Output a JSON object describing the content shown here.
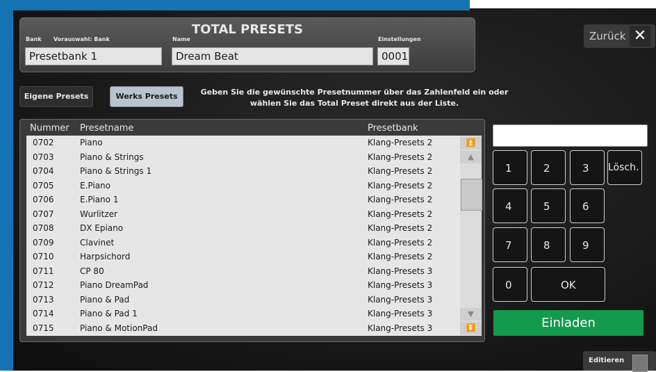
{
  "header": {
    "title": "TOTAL PRESETS",
    "bank_label": "Bank",
    "preselect_label": "Vorauswahl: Bank",
    "name_label": "Name",
    "settings_label": "Einstellungen",
    "bank_value": "Presetbank 1",
    "name_value": "Dream Beat",
    "settings_value": "0001"
  },
  "back_label": "Zurück",
  "tabs": {
    "own": "Eigene Presets",
    "works": "Werks Presets"
  },
  "hint": "Geben Sie die gewünschte Presetnummer über das Zahlenfeld ein oder wählen Sie das Total Preset direkt aus der Liste.",
  "table": {
    "columns": [
      "Nummer",
      "Presetname",
      "Presetbank"
    ],
    "rows": [
      [
        "0702",
        "Piano",
        "Klang-Presets 2"
      ],
      [
        "0703",
        "Piano & Strings",
        "Klang-Presets 2"
      ],
      [
        "0704",
        "Piano & Strings 1",
        "Klang-Presets 2"
      ],
      [
        "0705",
        "E.Piano",
        "Klang-Presets 2"
      ],
      [
        "0706",
        "E.Piano 1",
        "Klang-Presets 2"
      ],
      [
        "0707",
        "Wurlitzer",
        "Klang-Presets 2"
      ],
      [
        "0708",
        "DX Epiano",
        "Klang-Presets 2"
      ],
      [
        "0709",
        "Clavinet",
        "Klang-Presets 2"
      ],
      [
        "0710",
        "Harpsichord",
        "Klang-Presets 2"
      ],
      [
        "0711",
        "CP 80",
        "Klang-Presets 3"
      ],
      [
        "0712",
        "Piano DreamPad",
        "Klang-Presets 3"
      ],
      [
        "0713",
        "Piano & Pad",
        "Klang-Presets 3"
      ],
      [
        "0714",
        "Piano & Pad 1",
        "Klang-Presets 3"
      ],
      [
        "0715",
        "Piano & MotionPad",
        "Klang-Presets 3"
      ]
    ]
  },
  "keypad": {
    "k1": "1",
    "k2": "2",
    "k3": "3",
    "del": "Lösch.",
    "k4": "4",
    "k5": "5",
    "k6": "6",
    "k7": "7",
    "k8": "8",
    "k9": "9",
    "k0": "0",
    "ok": "OK"
  },
  "load_label": "Einladen",
  "edit_label": "Editieren",
  "colors": {
    "brand_blue": "#1473b3",
    "load_green": "#149a4c",
    "selected_tab": "#b8c4d0"
  }
}
